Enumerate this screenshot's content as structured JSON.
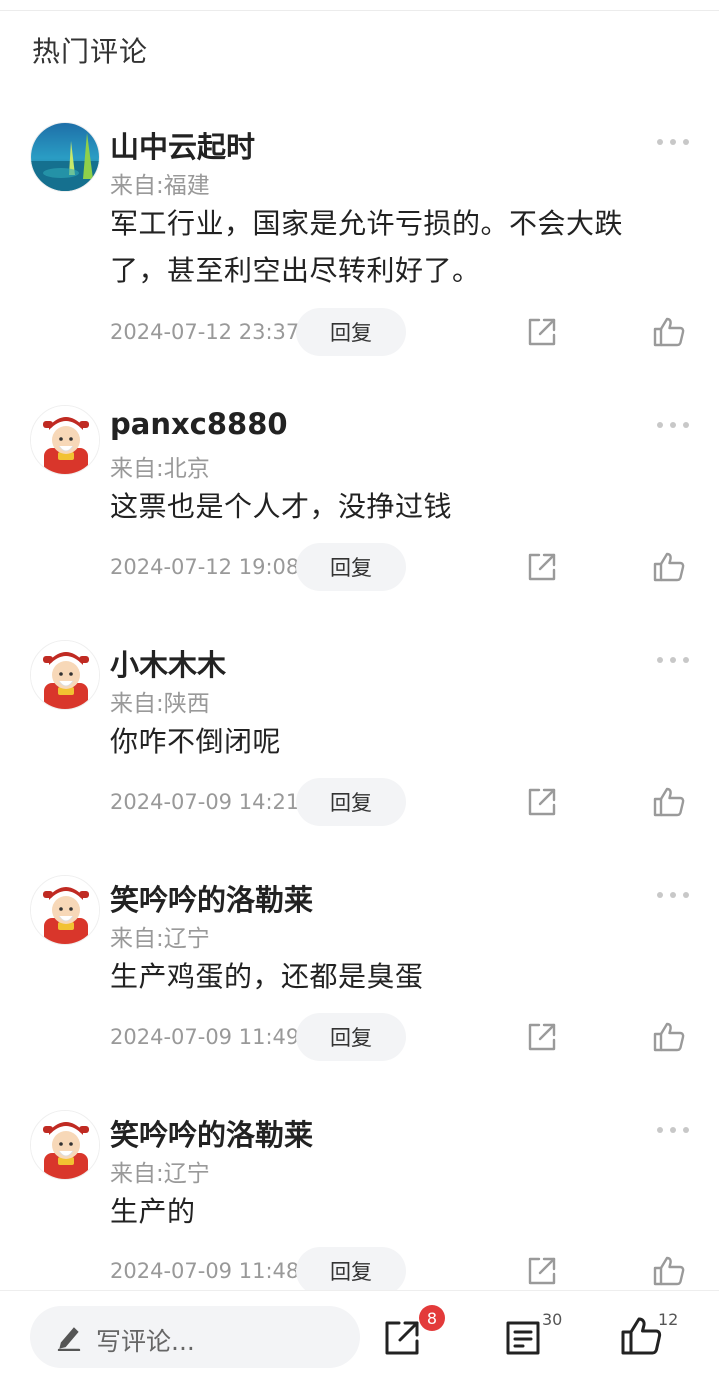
{
  "section_title": "热门评论",
  "comments": [
    {
      "username": "山中云起时",
      "origin": "来自:福建",
      "text": "军工行业，国家是允许亏损的。不会大跌了，甚至利空出尽转利好了。",
      "timestamp": "2024-07-12 23:37",
      "reply_label": "回复",
      "avatar": "landscape-photo"
    },
    {
      "username": "panxc8880",
      "origin": "来自:北京",
      "text": "这票也是个人才，没挣过钱",
      "timestamp": "2024-07-12 19:08",
      "reply_label": "回复",
      "avatar": "fortune-god"
    },
    {
      "username": "小木木木",
      "origin": "来自:陕西",
      "text": "你咋不倒闭呢",
      "timestamp": "2024-07-09 14:21",
      "reply_label": "回复",
      "avatar": "fortune-god"
    },
    {
      "username": "笑吟吟的洛勒莱",
      "origin": "来自:辽宁",
      "text": "生产鸡蛋的，还都是臭蛋",
      "timestamp": "2024-07-09 11:49",
      "reply_label": "回复",
      "avatar": "fortune-god"
    },
    {
      "username": "笑吟吟的洛勒莱",
      "origin": "来自:辽宁",
      "text": "生产的",
      "timestamp": "2024-07-09 11:48",
      "reply_label": "回复",
      "avatar": "fortune-god"
    }
  ],
  "bottom_bar": {
    "write_placeholder": "写评论...",
    "share_badge": "8",
    "comments_count": "30",
    "likes_count": "12"
  },
  "colors": {
    "badge": "#e33a3a",
    "muted_text": "#999999",
    "pill_bg": "#f3f4f6"
  },
  "icons": [
    "more-dots-icon",
    "share-icon",
    "thumbs-up-icon",
    "pen-icon",
    "comments-list-icon"
  ]
}
